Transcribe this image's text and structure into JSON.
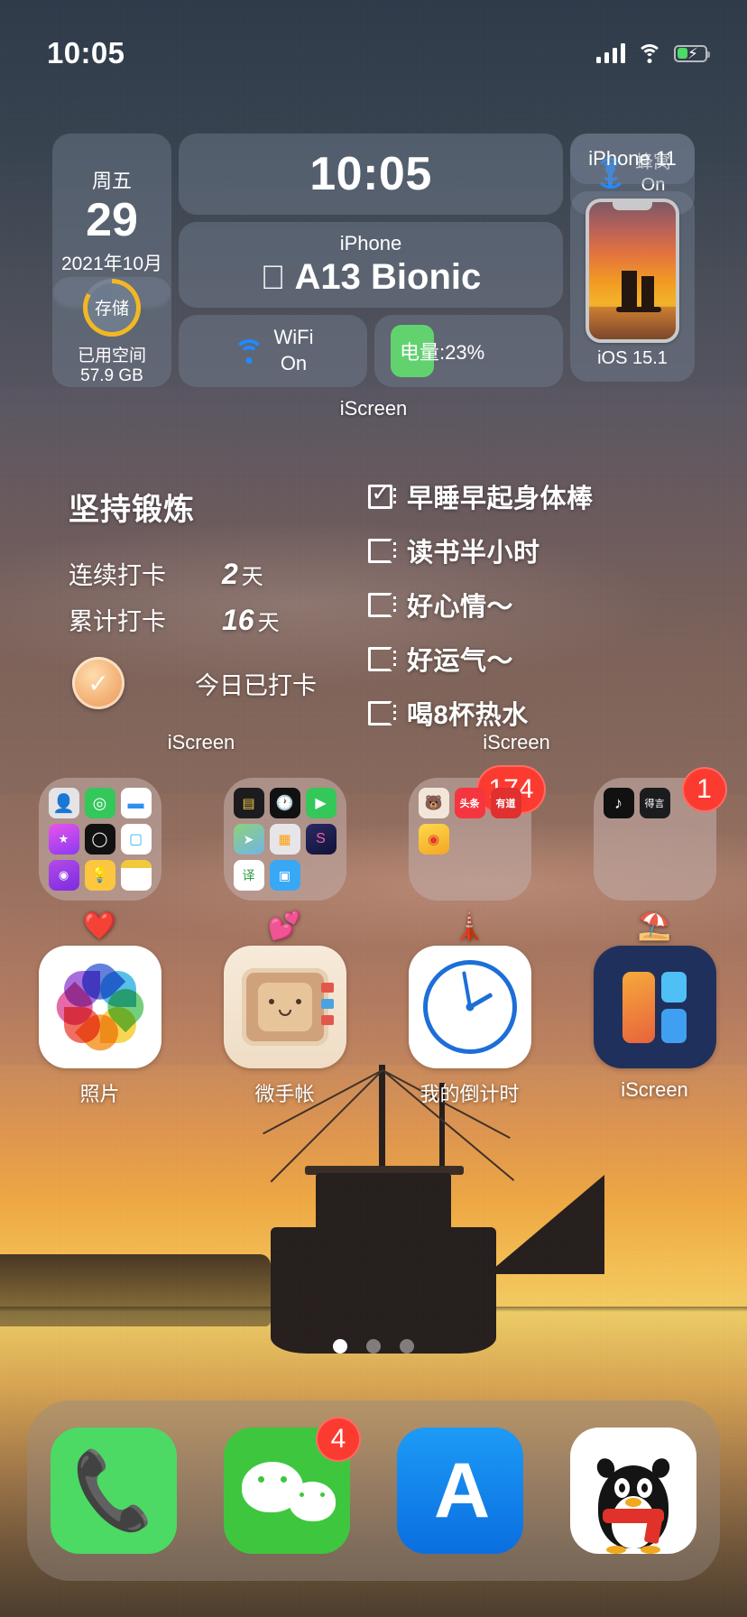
{
  "status_bar": {
    "time": "10:05",
    "cellular_icon": "signal-bars-icon",
    "wifi_icon": "wifi-icon",
    "battery_icon": "battery-charging-icon"
  },
  "system_widget": {
    "caption": "iScreen",
    "date": {
      "weekday": "周五",
      "day": "29",
      "year_month": "2021年10月"
    },
    "clock": {
      "time": "10:05"
    },
    "cellular": {
      "icon": "cellular-antenna-icon",
      "label": "蜂窝",
      "state": "On"
    },
    "storage": {
      "ring_label": "存储",
      "caption": "已用空间",
      "value": "57.9 GB",
      "ring_color": "#f2b824"
    },
    "chip": {
      "sub": "iPhone",
      "apple_glyph": "",
      "name": "A13 Bionic"
    },
    "wifi": {
      "icon": "wifi-icon",
      "label": "WiFi",
      "state": "On"
    },
    "battery": {
      "text": "电量:23%",
      "pill_color": "#62d26f"
    },
    "model": {
      "name": "iPhone 11"
    },
    "device": {
      "os": "iOS 15.1"
    }
  },
  "habit_widget": {
    "caption": "iScreen",
    "title": "坚持锻炼",
    "rows": [
      {
        "label": "连续打卡",
        "value": "2",
        "unit": "天"
      },
      {
        "label": "累计打卡",
        "value": "16",
        "unit": "天"
      }
    ],
    "stamp_icon": "checked-stamp-icon",
    "footer": "今日已打卡"
  },
  "checklist_widget": {
    "caption": "iScreen",
    "items": [
      {
        "text": "早睡早起身体棒",
        "checked": true
      },
      {
        "text": "读书半小时",
        "checked": false
      },
      {
        "text": "好心情～",
        "checked": false
      },
      {
        "text": "好运气～",
        "checked": false
      },
      {
        "text": "喝8杯热水",
        "checked": false
      }
    ]
  },
  "folder_row": [
    {
      "label": "❤️",
      "badge": "",
      "apps": [
        "contacts",
        "find-my",
        "files",
        "itunes-store",
        "watch",
        "wallet",
        "podcasts",
        "tips",
        "notes"
      ]
    },
    {
      "label": "💕",
      "badge": "",
      "apps": [
        "voice-memos",
        "clock",
        "facetime",
        "maps",
        "calculator",
        "shortcuts",
        "translate",
        "keynote"
      ]
    },
    {
      "label": "🗼",
      "badge": "174",
      "apps": [
        "soul",
        "toutiao",
        "youdao",
        "weibo"
      ]
    },
    {
      "label": "⛱️",
      "badge": "1",
      "apps": [
        "douyin",
        "deyan"
      ]
    }
  ],
  "app_row": [
    {
      "label": "照片",
      "icon": "photos-icon"
    },
    {
      "label": "微手帐",
      "icon": "notebook-icon"
    },
    {
      "label": "我的倒计时",
      "icon": "clock-icon"
    },
    {
      "label": "iScreen",
      "icon": "iscreen-icon"
    }
  ],
  "page_dots": {
    "count": 3,
    "active": 1
  },
  "dock": [
    {
      "name": "电话",
      "icon": "phone-icon",
      "badge": ""
    },
    {
      "name": "微信",
      "icon": "wechat-icon",
      "badge": "4"
    },
    {
      "name": "App Store",
      "icon": "appstore-icon",
      "badge": ""
    },
    {
      "name": "QQ",
      "icon": "qq-icon",
      "badge": ""
    }
  ]
}
